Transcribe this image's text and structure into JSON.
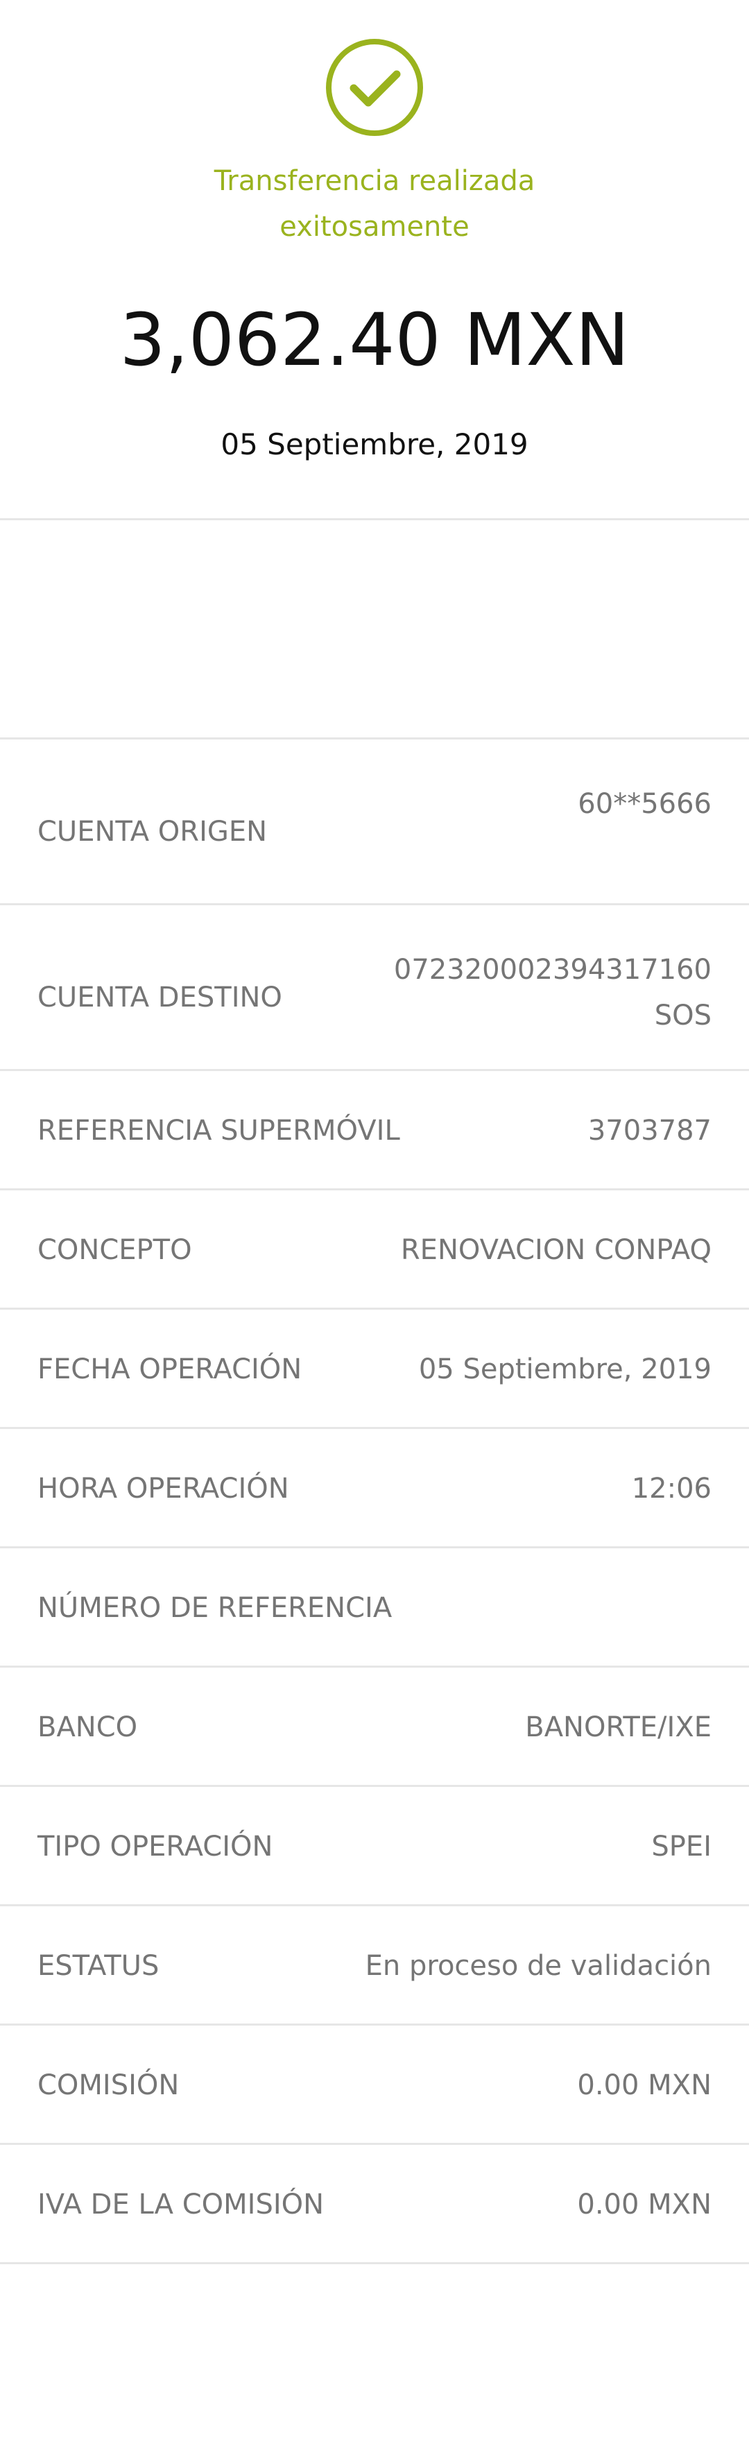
{
  "status": {
    "message_line1": "Transferencia realizada",
    "message_line2": "exitosamente",
    "amount": "3,062.40 MXN",
    "date": "05 Septiembre, 2019",
    "accent_color": "#9ab31e"
  },
  "details": {
    "cuenta_origen": {
      "label": "CUENTA ORIGEN",
      "value": "60**5666"
    },
    "cuenta_destino": {
      "label": "CUENTA DESTINO",
      "value_line1": "072320002394317160",
      "value_line2": "SOS"
    },
    "referencia_supermovil": {
      "label": "REFERENCIA SUPERMÓVIL",
      "value": "3703787"
    },
    "concepto": {
      "label": "CONCEPTO",
      "value": "RENOVACION CONPAQ"
    },
    "fecha_operacion": {
      "label": "FECHA OPERACIÓN",
      "value": "05 Septiembre, 2019"
    },
    "hora_operacion": {
      "label": "HORA OPERACIÓN",
      "value": "12:06"
    },
    "numero_referencia": {
      "label": "NÚMERO DE REFERENCIA",
      "value": ""
    },
    "banco": {
      "label": "BANCO",
      "value": "BANORTE/IXE"
    },
    "tipo_operacion": {
      "label": "TIPO OPERACIÓN",
      "value": "SPEI"
    },
    "estatus": {
      "label": "ESTATUS",
      "value": "En proceso de validación"
    },
    "comision": {
      "label": "COMISIÓN",
      "value": "0.00 MXN"
    },
    "iva_comision": {
      "label": "IVA DE LA COMISIÓN",
      "value": "0.00 MXN"
    }
  },
  "icons": {
    "success": "check-circle-icon"
  }
}
